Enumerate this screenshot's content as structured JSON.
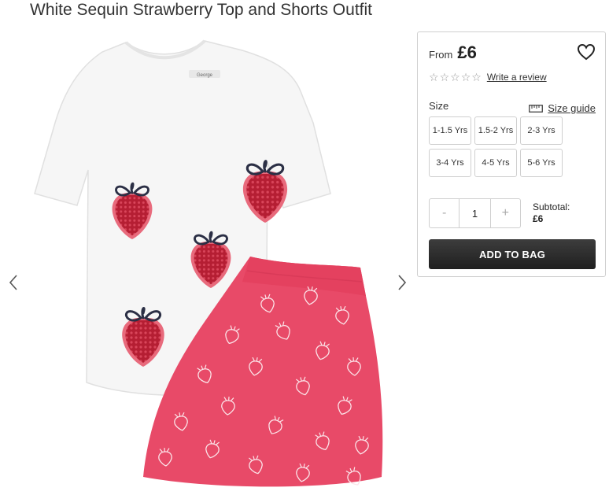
{
  "product": {
    "title": "White Sequin Strawberry Top and Shorts Outfit"
  },
  "gallery": {
    "prev_icon": "chevron-left-icon",
    "next_icon": "chevron-right-icon",
    "tshirt_label": "George",
    "colors": {
      "tshirt": "#f6f6f6",
      "shorts": "#e84a68",
      "sequin": "#b51e33",
      "bow": "#2b2f45"
    }
  },
  "buy_box": {
    "price_prefix": "From",
    "price": "£6",
    "wishlist_icon": "heart-icon",
    "rating_icon": "star-outline-icon",
    "write_review": "Write a review",
    "size_label": "Size",
    "size_guide": "Size guide",
    "size_guide_icon": "ruler-icon",
    "sizes": [
      "1-1.5 Yrs",
      "1.5-2 Yrs",
      "2-3 Yrs",
      "3-4 Yrs",
      "4-5 Yrs",
      "5-6 Yrs"
    ],
    "quantity": {
      "minus": "-",
      "value": "1",
      "plus": "+"
    },
    "subtotal_label": "Subtotal:",
    "subtotal_value": "£6",
    "add_to_bag": "ADD TO BAG",
    "button_color": "#2a2a2a"
  }
}
